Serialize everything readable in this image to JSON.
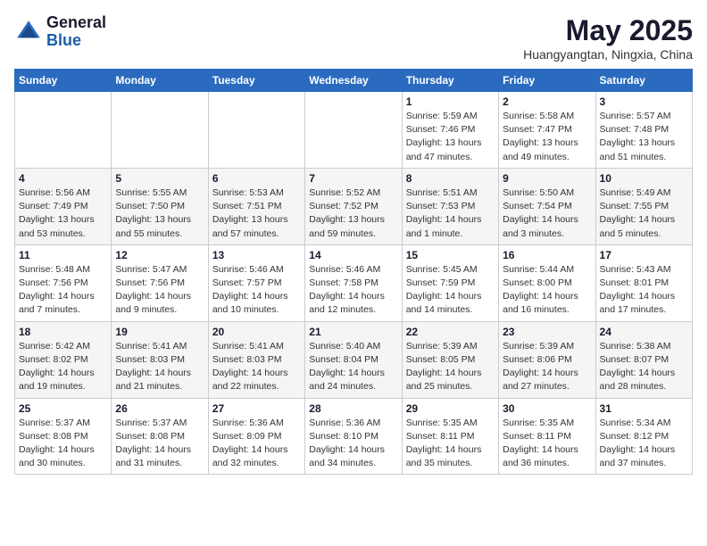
{
  "header": {
    "logo_line1": "General",
    "logo_line2": "Blue",
    "month": "May 2025",
    "location": "Huangyangtan, Ningxia, China"
  },
  "weekdays": [
    "Sunday",
    "Monday",
    "Tuesday",
    "Wednesday",
    "Thursday",
    "Friday",
    "Saturday"
  ],
  "weeks": [
    [
      {
        "day": "",
        "info": ""
      },
      {
        "day": "",
        "info": ""
      },
      {
        "day": "",
        "info": ""
      },
      {
        "day": "",
        "info": ""
      },
      {
        "day": "1",
        "info": "Sunrise: 5:59 AM\nSunset: 7:46 PM\nDaylight: 13 hours\nand 47 minutes."
      },
      {
        "day": "2",
        "info": "Sunrise: 5:58 AM\nSunset: 7:47 PM\nDaylight: 13 hours\nand 49 minutes."
      },
      {
        "day": "3",
        "info": "Sunrise: 5:57 AM\nSunset: 7:48 PM\nDaylight: 13 hours\nand 51 minutes."
      }
    ],
    [
      {
        "day": "4",
        "info": "Sunrise: 5:56 AM\nSunset: 7:49 PM\nDaylight: 13 hours\nand 53 minutes."
      },
      {
        "day": "5",
        "info": "Sunrise: 5:55 AM\nSunset: 7:50 PM\nDaylight: 13 hours\nand 55 minutes."
      },
      {
        "day": "6",
        "info": "Sunrise: 5:53 AM\nSunset: 7:51 PM\nDaylight: 13 hours\nand 57 minutes."
      },
      {
        "day": "7",
        "info": "Sunrise: 5:52 AM\nSunset: 7:52 PM\nDaylight: 13 hours\nand 59 minutes."
      },
      {
        "day": "8",
        "info": "Sunrise: 5:51 AM\nSunset: 7:53 PM\nDaylight: 14 hours\nand 1 minute."
      },
      {
        "day": "9",
        "info": "Sunrise: 5:50 AM\nSunset: 7:54 PM\nDaylight: 14 hours\nand 3 minutes."
      },
      {
        "day": "10",
        "info": "Sunrise: 5:49 AM\nSunset: 7:55 PM\nDaylight: 14 hours\nand 5 minutes."
      }
    ],
    [
      {
        "day": "11",
        "info": "Sunrise: 5:48 AM\nSunset: 7:56 PM\nDaylight: 14 hours\nand 7 minutes."
      },
      {
        "day": "12",
        "info": "Sunrise: 5:47 AM\nSunset: 7:56 PM\nDaylight: 14 hours\nand 9 minutes."
      },
      {
        "day": "13",
        "info": "Sunrise: 5:46 AM\nSunset: 7:57 PM\nDaylight: 14 hours\nand 10 minutes."
      },
      {
        "day": "14",
        "info": "Sunrise: 5:46 AM\nSunset: 7:58 PM\nDaylight: 14 hours\nand 12 minutes."
      },
      {
        "day": "15",
        "info": "Sunrise: 5:45 AM\nSunset: 7:59 PM\nDaylight: 14 hours\nand 14 minutes."
      },
      {
        "day": "16",
        "info": "Sunrise: 5:44 AM\nSunset: 8:00 PM\nDaylight: 14 hours\nand 16 minutes."
      },
      {
        "day": "17",
        "info": "Sunrise: 5:43 AM\nSunset: 8:01 PM\nDaylight: 14 hours\nand 17 minutes."
      }
    ],
    [
      {
        "day": "18",
        "info": "Sunrise: 5:42 AM\nSunset: 8:02 PM\nDaylight: 14 hours\nand 19 minutes."
      },
      {
        "day": "19",
        "info": "Sunrise: 5:41 AM\nSunset: 8:03 PM\nDaylight: 14 hours\nand 21 minutes."
      },
      {
        "day": "20",
        "info": "Sunrise: 5:41 AM\nSunset: 8:03 PM\nDaylight: 14 hours\nand 22 minutes."
      },
      {
        "day": "21",
        "info": "Sunrise: 5:40 AM\nSunset: 8:04 PM\nDaylight: 14 hours\nand 24 minutes."
      },
      {
        "day": "22",
        "info": "Sunrise: 5:39 AM\nSunset: 8:05 PM\nDaylight: 14 hours\nand 25 minutes."
      },
      {
        "day": "23",
        "info": "Sunrise: 5:39 AM\nSunset: 8:06 PM\nDaylight: 14 hours\nand 27 minutes."
      },
      {
        "day": "24",
        "info": "Sunrise: 5:38 AM\nSunset: 8:07 PM\nDaylight: 14 hours\nand 28 minutes."
      }
    ],
    [
      {
        "day": "25",
        "info": "Sunrise: 5:37 AM\nSunset: 8:08 PM\nDaylight: 14 hours\nand 30 minutes."
      },
      {
        "day": "26",
        "info": "Sunrise: 5:37 AM\nSunset: 8:08 PM\nDaylight: 14 hours\nand 31 minutes."
      },
      {
        "day": "27",
        "info": "Sunrise: 5:36 AM\nSunset: 8:09 PM\nDaylight: 14 hours\nand 32 minutes."
      },
      {
        "day": "28",
        "info": "Sunrise: 5:36 AM\nSunset: 8:10 PM\nDaylight: 14 hours\nand 34 minutes."
      },
      {
        "day": "29",
        "info": "Sunrise: 5:35 AM\nSunset: 8:11 PM\nDaylight: 14 hours\nand 35 minutes."
      },
      {
        "day": "30",
        "info": "Sunrise: 5:35 AM\nSunset: 8:11 PM\nDaylight: 14 hours\nand 36 minutes."
      },
      {
        "day": "31",
        "info": "Sunrise: 5:34 AM\nSunset: 8:12 PM\nDaylight: 14 hours\nand 37 minutes."
      }
    ]
  ]
}
